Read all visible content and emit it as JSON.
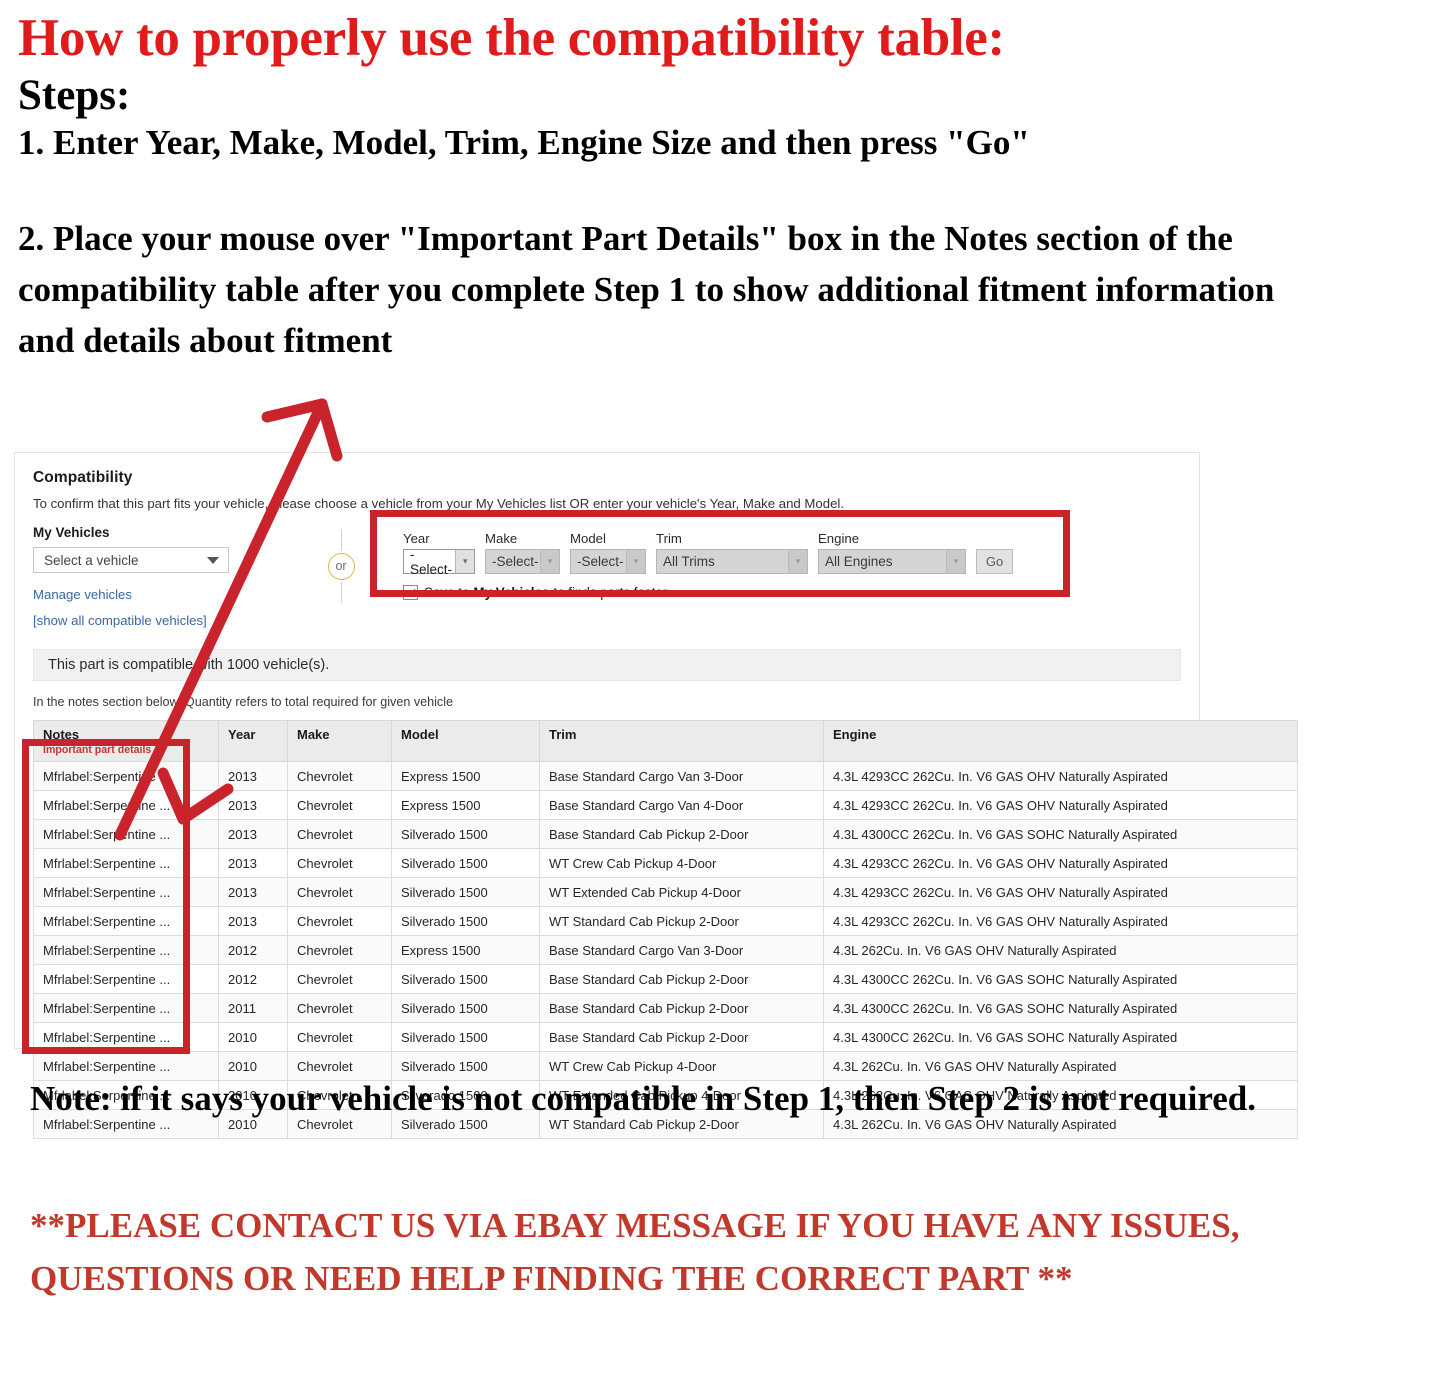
{
  "instructions": {
    "title": "How to properly use the compatibility table:",
    "steps_heading": "Steps:",
    "step1": "1. Enter Year, Make, Model, Trim, Engine Size and then press \"Go\"",
    "step2": "2. Place your mouse over \"Important Part Details\" box in the Notes section of the compatibility table after you complete Step 1 to show additional fitment information and details about fitment"
  },
  "compatibility": {
    "title": "Compatibility",
    "subtitle": "To confirm that this part fits your vehicle, please choose a vehicle from your My Vehicles list OR enter your vehicle's Year, Make and Model.",
    "my_vehicles": {
      "label": "My Vehicles",
      "select_value": "Select a vehicle",
      "manage_link": "Manage vehicles",
      "show_all_link": "[show all compatible vehicles]"
    },
    "divider_text": "or",
    "form": {
      "year": {
        "label": "Year",
        "value": "-Select-"
      },
      "make": {
        "label": "Make",
        "value": "-Select-"
      },
      "model": {
        "label": "Model",
        "value": "-Select-"
      },
      "trim": {
        "label": "Trim",
        "value": "All Trims"
      },
      "engine": {
        "label": "Engine",
        "value": "All Engines"
      },
      "go_label": "Go",
      "save_prefix": "Save to",
      "save_bold": "My Vehicles",
      "save_suffix": "to finds parts faster"
    },
    "banner": "This part is compatible with 1000 vehicle(s).",
    "qty_note": "In the notes section below, Quantity refers to total required for given vehicle",
    "table": {
      "headers": {
        "notes": "Notes",
        "notes_sub": "Important part details",
        "year": "Year",
        "make": "Make",
        "model": "Model",
        "trim": "Trim",
        "engine": "Engine"
      },
      "rows": [
        {
          "notes": "Mfrlabel:Serpentine ...",
          "year": "2013",
          "make": "Chevrolet",
          "model": "Express 1500",
          "trim": "Base Standard Cargo Van 3-Door",
          "engine": "4.3L 4293CC 262Cu. In. V6 GAS OHV Naturally Aspirated"
        },
        {
          "notes": "Mfrlabel:Serpentine ...",
          "year": "2013",
          "make": "Chevrolet",
          "model": "Express 1500",
          "trim": "Base Standard Cargo Van 4-Door",
          "engine": "4.3L 4293CC 262Cu. In. V6 GAS OHV Naturally Aspirated"
        },
        {
          "notes": "Mfrlabel:Serpentine ...",
          "year": "2013",
          "make": "Chevrolet",
          "model": "Silverado 1500",
          "trim": "Base Standard Cab Pickup 2-Door",
          "engine": "4.3L 4300CC 262Cu. In. V6 GAS SOHC Naturally Aspirated"
        },
        {
          "notes": "Mfrlabel:Serpentine ...",
          "year": "2013",
          "make": "Chevrolet",
          "model": "Silverado 1500",
          "trim": "WT Crew Cab Pickup 4-Door",
          "engine": "4.3L 4293CC 262Cu. In. V6 GAS OHV Naturally Aspirated"
        },
        {
          "notes": "Mfrlabel:Serpentine ...",
          "year": "2013",
          "make": "Chevrolet",
          "model": "Silverado 1500",
          "trim": "WT Extended Cab Pickup 4-Door",
          "engine": "4.3L 4293CC 262Cu. In. V6 GAS OHV Naturally Aspirated"
        },
        {
          "notes": "Mfrlabel:Serpentine ...",
          "year": "2013",
          "make": "Chevrolet",
          "model": "Silverado 1500",
          "trim": "WT Standard Cab Pickup 2-Door",
          "engine": "4.3L 4293CC 262Cu. In. V6 GAS OHV Naturally Aspirated"
        },
        {
          "notes": "Mfrlabel:Serpentine ...",
          "year": "2012",
          "make": "Chevrolet",
          "model": "Express 1500",
          "trim": "Base Standard Cargo Van 3-Door",
          "engine": "4.3L 262Cu. In. V6 GAS OHV Naturally Aspirated"
        },
        {
          "notes": "Mfrlabel:Serpentine ...",
          "year": "2012",
          "make": "Chevrolet",
          "model": "Silverado 1500",
          "trim": "Base Standard Cab Pickup 2-Door",
          "engine": "4.3L 4300CC 262Cu. In. V6 GAS SOHC Naturally Aspirated"
        },
        {
          "notes": "Mfrlabel:Serpentine ...",
          "year": "2011",
          "make": "Chevrolet",
          "model": "Silverado 1500",
          "trim": "Base Standard Cab Pickup 2-Door",
          "engine": "4.3L 4300CC 262Cu. In. V6 GAS SOHC Naturally Aspirated"
        },
        {
          "notes": "Mfrlabel:Serpentine ...",
          "year": "2010",
          "make": "Chevrolet",
          "model": "Silverado 1500",
          "trim": "Base Standard Cab Pickup 2-Door",
          "engine": "4.3L 4300CC 262Cu. In. V6 GAS SOHC Naturally Aspirated"
        },
        {
          "notes": "Mfrlabel:Serpentine ...",
          "year": "2010",
          "make": "Chevrolet",
          "model": "Silverado 1500",
          "trim": "WT Crew Cab Pickup 4-Door",
          "engine": "4.3L 262Cu. In. V6 GAS OHV Naturally Aspirated"
        },
        {
          "notes": "Mfrlabel:Serpentine ...",
          "year": "2010",
          "make": "Chevrolet",
          "model": "Silverado 1500",
          "trim": "WT Extended Cab Pickup 4-Door",
          "engine": "4.3L 262Cu. In. V6 GAS OHV Naturally Aspirated"
        },
        {
          "notes": "Mfrlabel:Serpentine ...",
          "year": "2010",
          "make": "Chevrolet",
          "model": "Silverado 1500",
          "trim": "WT Standard Cab Pickup 2-Door",
          "engine": "4.3L 262Cu. In. V6 GAS OHV Naturally Aspirated"
        }
      ]
    }
  },
  "footer": {
    "note": "Note: if it says your vehicle is not compatible in Step 1, then Step 2 is not required.",
    "contact": "**PLEASE CONTACT US VIA EBAY MESSAGE IF YOU HAVE ANY ISSUES, QUESTIONS OR NEED HELP FINDING THE CORRECT PART **"
  },
  "colors": {
    "accent_red": "#c0392b",
    "annotation_red": "#c9242b",
    "link_blue": "#3668a8"
  }
}
